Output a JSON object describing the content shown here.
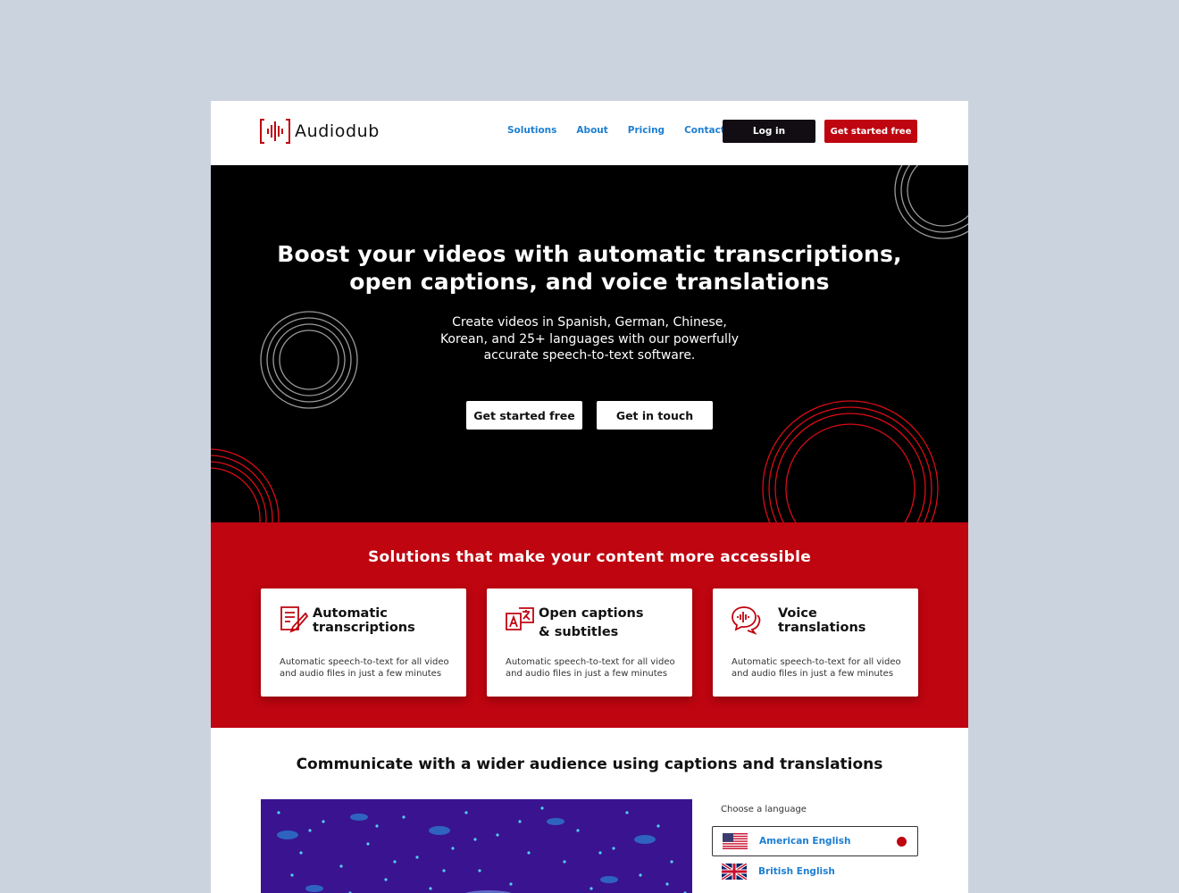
{
  "brand": {
    "name": "Audiodub",
    "accent": "#be0510",
    "link_color": "#1d7fd1"
  },
  "nav": {
    "items": [
      {
        "label": "Solutions"
      },
      {
        "label": "About"
      },
      {
        "label": "Pricing"
      },
      {
        "label": "Contact"
      }
    ],
    "login_label": "Log in",
    "cta_label": "Get started free"
  },
  "hero": {
    "title_line1": "Boost your videos with automatic transcriptions,",
    "title_line2": "open captions, and voice translations",
    "subtitle": "Create videos in Spanish, German, Chinese, Korean, and 25+ languages with our powerfully accurate speech-to-text software.",
    "primary_button": "Get started free",
    "secondary_button": "Get in touch"
  },
  "solutions": {
    "title": "Solutions that make your content more accessible",
    "cards": [
      {
        "icon": "document-pen-icon",
        "title": "Automatic\ntranscriptions",
        "description": "Automatic speech-to-text for all video and audio files in just a few minutes"
      },
      {
        "icon": "translate-icon",
        "title": "Open captions\n& subtitles",
        "description": "Automatic speech-to-text for all video and audio files in just a few minutes"
      },
      {
        "icon": "speech-bubbles-icon",
        "title": "Voice\ntranslations",
        "description": "Automatic speech-to-text for all video and audio files in just a few minutes"
      }
    ]
  },
  "communicate": {
    "title": "Communicate with a wider audience using captions and translations",
    "language_label": "Choose a language",
    "languages": [
      {
        "name": "American English",
        "flag": "us-flag-icon",
        "selected": true
      },
      {
        "name": "British English",
        "flag": "uk-flag-icon",
        "selected": false
      }
    ]
  }
}
